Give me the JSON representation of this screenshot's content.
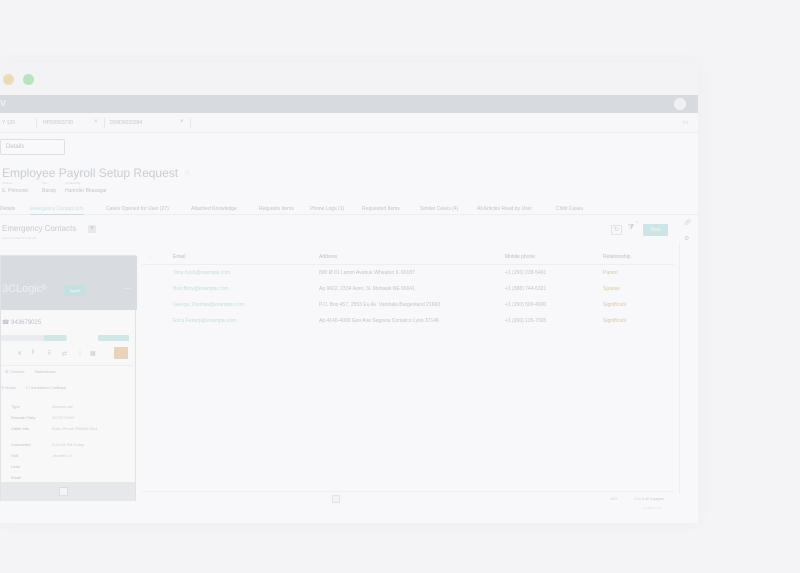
{
  "window": {
    "app_logo": "v",
    "tabs": [
      "Y 126",
      "HPD0563730",
      "D09D0033394"
    ]
  },
  "record": {
    "details_button": "Details",
    "title": "Employee Payroll Setup Request",
    "meta_labels": [
      "Contact",
      "Cat",
      "Created By"
    ],
    "meta_values": [
      "E. Petrovne",
      "Bandy",
      "Harinder Bhasagar"
    ]
  },
  "subtabs": [
    "Details",
    "Emergency Contact Info",
    "Cases Opened for User (27)",
    "Attached Knowledge",
    "Requests Items",
    "Phone Logs (1)",
    "Requested Items",
    "Similar Cases (4)",
    "All Articles Read by User",
    "Child Cases"
  ],
  "section": {
    "title": "Emergency Contacts",
    "add": "+",
    "subtitle": "Last refreshed at 5:20 AM",
    "new_button": "New",
    "filter_count": "0"
  },
  "grid": {
    "headers": [
      "Email",
      "Address",
      "Mobile phone",
      "Relationship"
    ],
    "rows": [
      {
        "email": "Tony.hush@example.com",
        "address": "890 Ø 01 Lamm Avenue Wheaton IL 60187",
        "phone": "+1 (156) 238-5491",
        "relationship": "Parent"
      },
      {
        "email": "Bret.Broy@example.com",
        "address": "Ap 9602, 2334 Aore, 3L Mohawk NE 66041",
        "phone": "+1 (388) 744-5321",
        "relationship": "Spouse"
      },
      {
        "email": "George.Thomas@example.com",
        "address": "P.O. Box 457, 2553 Eu Av. Vandalia Burgenland 21663",
        "phone": "+1 (150) 509-4600",
        "relationship": "Significant"
      },
      {
        "email": "Erica.Fenerp@example.com",
        "address": "Ap 4140-4000 Gen Ave Segovia Comalco Lyon 37146",
        "phone": "+1 (260) 135-7305",
        "relationship": "Significant"
      }
    ],
    "page_size": "100",
    "page_info": "1 to 4 of 4 pages",
    "footer_note": "Loaded 4 rows"
  },
  "panel": {
    "brand": "3CLogic",
    "brand_mark": "ᵇ",
    "beta_badge": "Agent",
    "phone_label": "☎ 943679025",
    "tab_1": "☰ Timeline",
    "tab_2": "Tasks/Notes",
    "action_1": "✎ Notes",
    "action_2": "☐ Scheduled Callback",
    "fields": [
      {
        "label": "Type",
        "value": "Internal call"
      },
      {
        "label": "Remote Party",
        "value": "3673073099"
      },
      {
        "label": "Caller Info",
        "value": "Brian Phone 9909517614"
      },
      {
        "label": "Connected",
        "value": "5:24:03 PM Today"
      },
      {
        "label": "Skill",
        "value": "Jennifer Lit"
      },
      {
        "label": "Lead",
        "value": ""
      },
      {
        "label": "Email",
        "value": ""
      },
      {
        "label": "Notes",
        "value": "- - - -"
      }
    ]
  }
}
